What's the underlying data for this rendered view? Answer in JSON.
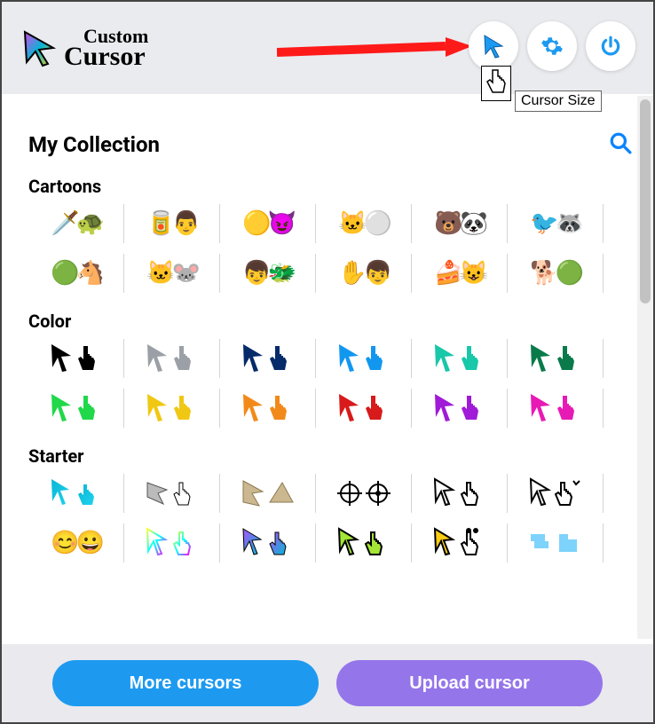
{
  "header": {
    "logo_top": "Custom",
    "logo_bot": "Cursor"
  },
  "tooltip": "Cursor Size",
  "title": "My Collection",
  "categories": [
    {
      "name": "Cartoons",
      "rows": [
        [
          "pair",
          "pair",
          "pair",
          "pair",
          "pair",
          "pair"
        ],
        [
          "pair",
          "pair",
          "pair",
          "pair",
          "pair",
          "pair"
        ]
      ]
    },
    {
      "name": "Color",
      "rows": [
        [
          {
            "arrow": "#000000",
            "hand": "#000000"
          },
          {
            "arrow": "#9aa0a6",
            "hand": "#9aa0a6"
          },
          {
            "arrow": "#062b6b",
            "hand": "#062b6b"
          },
          {
            "arrow": "#1297f0",
            "hand": "#1297f0"
          },
          {
            "arrow": "#19c7a9",
            "hand": "#19c7a9"
          },
          {
            "arrow": "#0a7a4a",
            "hand": "#0a7a4a"
          }
        ],
        [
          {
            "arrow": "#20d84a",
            "hand": "#20d84a"
          },
          {
            "arrow": "#f0c813",
            "hand": "#f0c813"
          },
          {
            "arrow": "#f28a1a",
            "hand": "#f28a1a"
          },
          {
            "arrow": "#d81a1a",
            "hand": "#d81a1a"
          },
          {
            "arrow": "#a01ad8",
            "hand": "#a01ad8"
          },
          {
            "arrow": "#e81ab5",
            "hand": "#e81ab5"
          }
        ]
      ]
    },
    {
      "name": "Starter",
      "rows": [
        [
          "pair",
          "pair",
          "pair",
          "pair",
          "pair",
          "pair"
        ],
        [
          "pair",
          "pair",
          "pair",
          "pair",
          "pair",
          "pair"
        ]
      ]
    }
  ],
  "footer": {
    "more": "More cursors",
    "upload": "Upload cursor"
  }
}
